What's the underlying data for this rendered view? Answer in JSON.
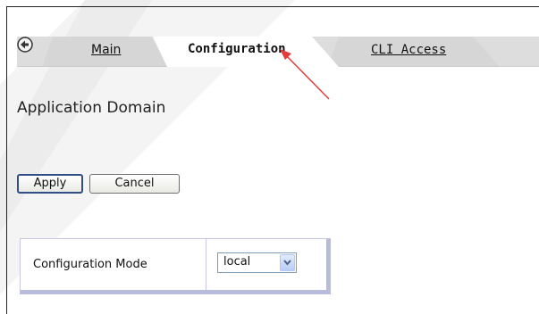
{
  "tabs": {
    "back_icon": "back-arrow-icon",
    "main_label": "Main",
    "configuration_label": "Configuration",
    "cli_label": "CLI Access"
  },
  "page": {
    "title": "Application Domain"
  },
  "buttons": {
    "apply_label": "Apply",
    "cancel_label": "Cancel"
  },
  "form": {
    "configuration_mode_label": "Configuration Mode",
    "configuration_mode_value": "local"
  },
  "colors": {
    "tab_strip": "#dcdcdc",
    "active_tab": "#ffffff",
    "annotation_arrow": "#e33a3a",
    "table_border": "#b9bbdc"
  }
}
